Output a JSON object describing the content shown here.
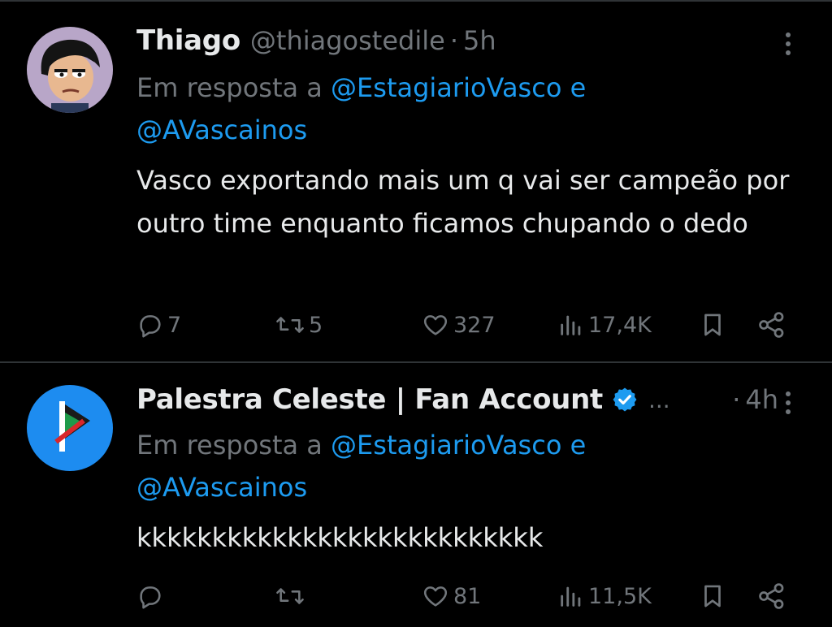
{
  "tweets": [
    {
      "name": "Thiago",
      "handle": "@thiagostedile",
      "dot": "·",
      "time": "5h",
      "reply_prefix": "Em resposta a ",
      "reply_mention_1": "@EstagiarioVasco",
      "reply_conj": " e",
      "reply_mention_2": "@AVascainos",
      "text": "Vasco exportando mais um q vai ser campeão por outro time enquanto ficamos chupando o dedo",
      "reply_count": "7",
      "retweet_count": "5",
      "like_count": "327",
      "view_count": "17,4K"
    },
    {
      "name": "Palestra Celeste | Fan Account",
      "ellipsis": "...",
      "dot": "·",
      "time": "4h",
      "reply_prefix": "Em resposta a ",
      "reply_mention_1": "@EstagiarioVasco",
      "reply_conj": " e",
      "reply_mention_2": "@AVascainos",
      "text": "kkkkkkkkkkkkkkkkkkkkkkkkkkk",
      "reply_count": "",
      "retweet_count": "",
      "like_count": "81",
      "view_count": "11,5K"
    }
  ],
  "colors": {
    "background": "#000000",
    "text": "#e7e9ea",
    "muted": "#71767b",
    "link": "#1d9bf0",
    "divider": "#2f3336"
  },
  "icons": [
    "more-icon",
    "reply-icon",
    "retweet-icon",
    "like-icon",
    "views-icon",
    "bookmark-icon",
    "share-icon",
    "verified-icon"
  ]
}
